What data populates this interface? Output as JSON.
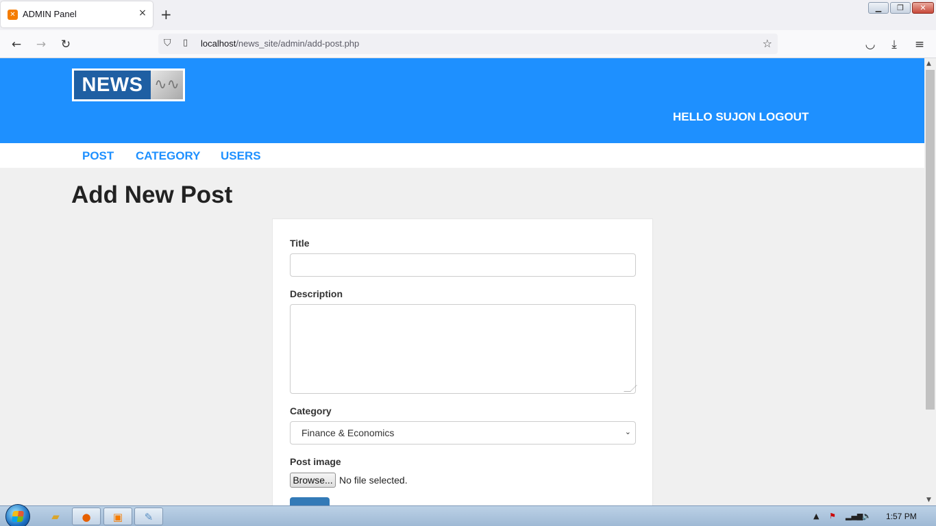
{
  "browser": {
    "tab_title": "ADMIN Panel",
    "tab_close": "×",
    "new_tab": "+",
    "url_host": "localhost",
    "url_path": "/news_site/admin/add-post.php",
    "back": "←",
    "forward": "→",
    "reload": "↻",
    "star": "☆",
    "pocket": "◡",
    "download": "⤓",
    "menu": "≡",
    "win_min": "▁",
    "win_max": "❐",
    "win_close": "✕"
  },
  "site": {
    "logo_text": "NEWS",
    "logo_mark": "∿∿",
    "greeting": "HELLO SUJON LOGOUT",
    "menu": [
      {
        "label": "POST"
      },
      {
        "label": "CATEGORY"
      },
      {
        "label": "USERS"
      }
    ],
    "colors": {
      "header": "#1e90ff",
      "menu_link": "#1e90ff",
      "submit": "#337ab7"
    }
  },
  "page": {
    "title": "Add New Post"
  },
  "form": {
    "title_label": "Title",
    "title_value": "",
    "description_label": "Description",
    "description_value": "",
    "category_label": "Category",
    "category_selected": "Finance & Economics",
    "image_label": "Post image",
    "browse_label": "Browse...",
    "file_status": "No file selected."
  },
  "taskbar": {
    "clock": "1:57 PM",
    "items": [
      {
        "name": "explorer",
        "icon": "folder-icon"
      },
      {
        "name": "firefox",
        "icon": "firefox-icon"
      },
      {
        "name": "xampp",
        "icon": "xampp-icon"
      },
      {
        "name": "paint",
        "icon": "paint-icon"
      }
    ]
  }
}
